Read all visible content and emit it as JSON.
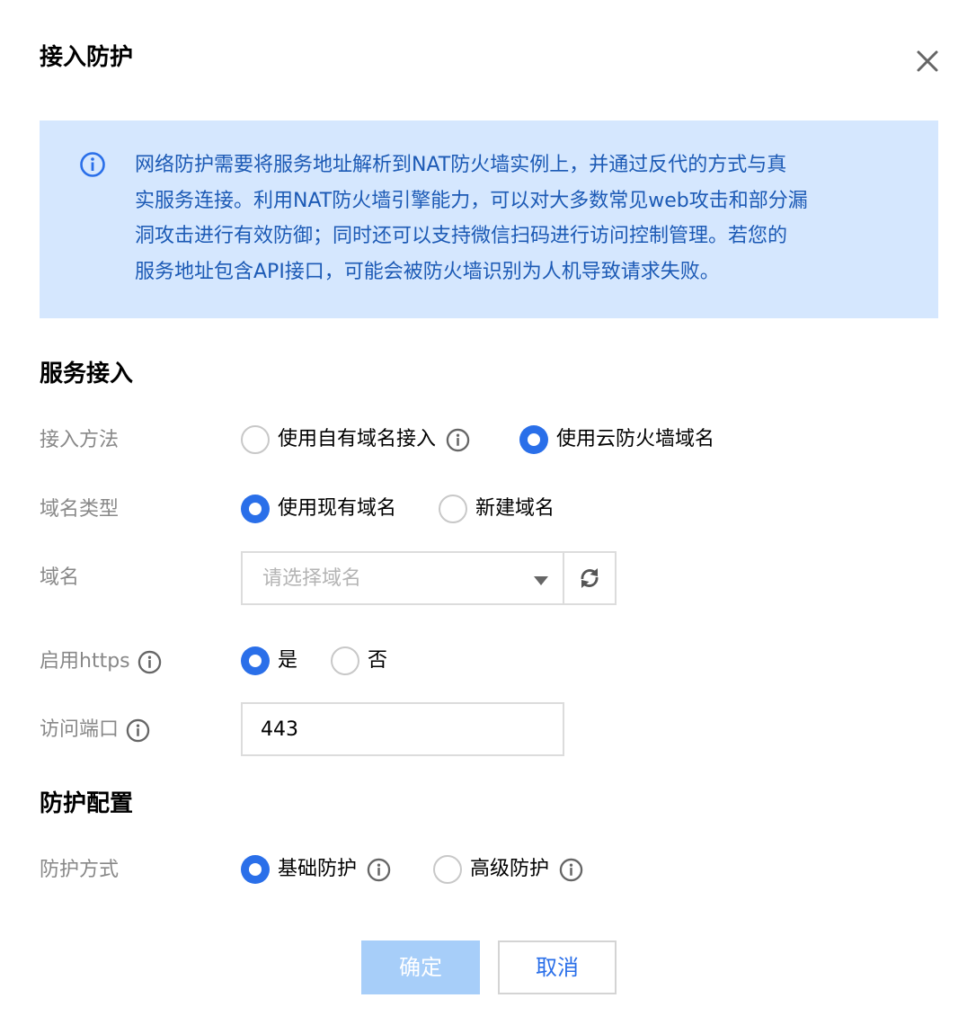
{
  "dialog": {
    "title": "接入防护",
    "notice_lines": [
      "网络防护需要将服务地址解析到NAT防火墙实例上，并通过反代的方式与真",
      "实服务连接。利用NAT防火墙引擎能力，可以对大多数常见web攻击和部分漏",
      "洞攻击进行有效防御；同时还可以支持微信扫码进行访问控制管理。若您的",
      "服务地址包含API接口，可能会被防火墙识别为人机导致请求失败。"
    ]
  },
  "service": {
    "section_title": "服务接入",
    "access_method": {
      "label": "接入方法",
      "options": [
        "使用自有域名接入",
        "使用云防火墙域名"
      ],
      "selected": "使用云防火墙域名"
    },
    "domain_type": {
      "label": "域名类型",
      "options": [
        "使用现有域名",
        "新建域名"
      ],
      "selected": "使用现有域名"
    },
    "domain": {
      "label": "域名",
      "placeholder": "请选择域名"
    },
    "https": {
      "label": "启用https",
      "options": [
        "是",
        "否"
      ],
      "selected": "是"
    },
    "port": {
      "label": "访问端口",
      "value": "443"
    }
  },
  "protection": {
    "section_title": "防护配置",
    "mode": {
      "label": "防护方式",
      "options": [
        "基础防护",
        "高级防护"
      ],
      "selected": "基础防护"
    }
  },
  "footer": {
    "ok_label": "确定",
    "cancel_label": "取消"
  },
  "colors": {
    "accent": "#2a6fe9",
    "notice_bg": "#d5e7fe",
    "notice_text": "#1c5ab5",
    "ok_disabled_bg": "#a7cef9"
  }
}
